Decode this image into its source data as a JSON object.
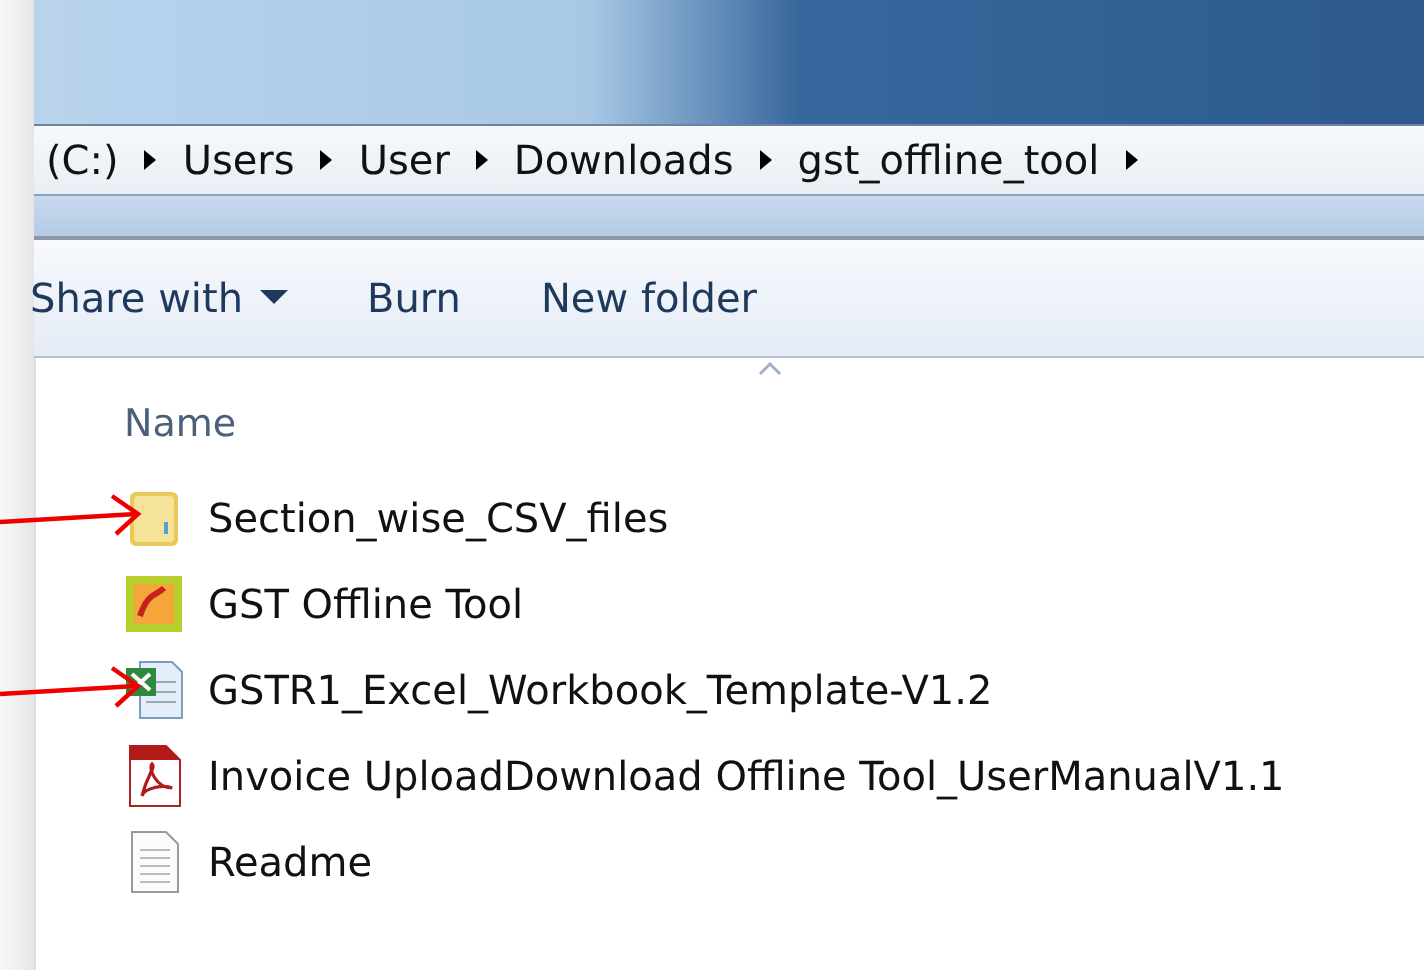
{
  "address_bar": {
    "segments": [
      "(C:)",
      "Users",
      "User",
      "Downloads",
      "gst_offline_tool"
    ]
  },
  "toolbar": [
    {
      "label": "Share with",
      "has_menu": true
    },
    {
      "label": "Burn",
      "has_menu": false
    },
    {
      "label": "New folder",
      "has_menu": false
    }
  ],
  "file_list": {
    "columns": [
      {
        "label": "Name",
        "sorted": true
      }
    ],
    "items": [
      {
        "name": "Section_wise_CSV_files",
        "kind": "folder",
        "annotated": true
      },
      {
        "name": "GST Offline Tool",
        "kind": "app",
        "annotated": false
      },
      {
        "name": "GSTR1_Excel_Workbook_Template-V1.2",
        "kind": "excel",
        "annotated": true
      },
      {
        "name": "Invoice UploadDownload Offline Tool_UserManualV1.1",
        "kind": "pdf",
        "annotated": false
      },
      {
        "name": "Readme",
        "kind": "text",
        "annotated": false
      }
    ]
  }
}
